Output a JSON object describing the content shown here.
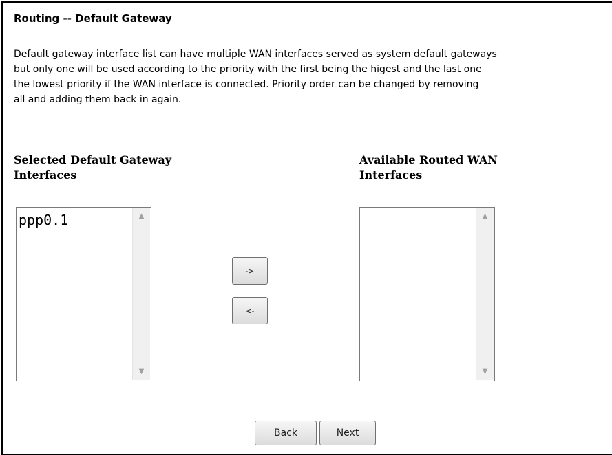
{
  "page": {
    "title": "Routing -- Default Gateway",
    "description_lines": [
      "Default gateway interface list can have multiple WAN interfaces served as system default gateways",
      "but only one will be used according to the priority with the first being the higest and the last one",
      "the lowest priority if the WAN interface is connected. Priority order can be changed by removing",
      "all and adding them back in again."
    ]
  },
  "selected": {
    "heading_line1": "Selected Default Gateway",
    "heading_line2": "Interfaces",
    "items": [
      "ppp0.1"
    ]
  },
  "available": {
    "heading_line1": "Available Routed WAN",
    "heading_line2": "Interfaces",
    "items": []
  },
  "controls": {
    "move_right_label": "->",
    "move_left_label": "<-",
    "back_label": "Back",
    "next_label": "Next"
  },
  "icons": {
    "scroll_up": "triangle-up-icon",
    "scroll_down": "triangle-down-icon"
  }
}
